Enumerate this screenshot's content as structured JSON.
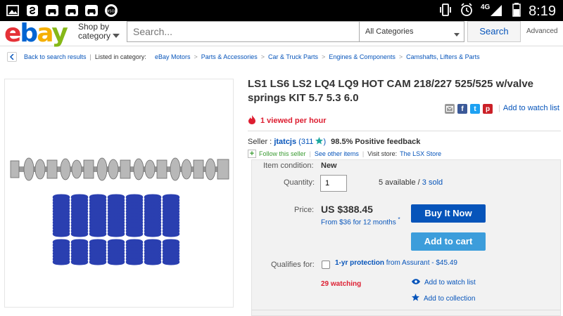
{
  "status_bar": {
    "time": "8:19",
    "network": "4G",
    "left_icons": [
      "gallery-icon",
      "shazam-icon",
      "car-icon",
      "car-icon",
      "car-icon",
      "wsop-icon"
    ],
    "right_icons": [
      "vibrate-icon",
      "alarm-icon",
      "signal-icon",
      "battery-icon"
    ]
  },
  "header": {
    "logo": {
      "e": "e",
      "b": "b",
      "a": "a",
      "y": "y"
    },
    "shop_by_line1": "Shop by",
    "shop_by_line2": "category",
    "search_placeholder": "Search...",
    "category_selected": "All Categories",
    "search_button": "Search",
    "advanced": "Advanced"
  },
  "breadcrumb": {
    "back": "Back to search results",
    "listed_in": "Listed in category:",
    "items": [
      "eBay Motors",
      "Parts & Accessories",
      "Car & Truck Parts",
      "Engines & Components",
      "Camshafts, Lifters & Parts"
    ]
  },
  "listing": {
    "title": "LS1 LS6 LS2 LQ4 LQ9 HOT CAM 218/227 525/525 w/valve springs KIT 5.7 5.3 6.0",
    "viewed": "1 viewed per hour",
    "watch_list_link": "Add to watch list",
    "share_icons": [
      "email-icon",
      "facebook-icon",
      "twitter-icon",
      "pinterest-icon"
    ]
  },
  "seller": {
    "label": "Seller :",
    "name": "jtatcjs",
    "feedback_count": "(311",
    "feedback_close": ")",
    "positive": "98.5% Positive feedback",
    "follow": "Follow this seller",
    "see_other": "See other items",
    "visit_label": "Visit store:",
    "store": "The LSX Store"
  },
  "purchase": {
    "condition_label": "Item condition:",
    "condition_value": "New",
    "quantity_label": "Quantity:",
    "quantity_value": "1",
    "available": "5 available /",
    "sold": "3 sold",
    "price_label": "Price:",
    "price": "US $388.45",
    "monthly": "From $36 for 12 months",
    "monthly_mark": "*",
    "buy_now": "Buy It Now",
    "add_to_cart": "Add to cart",
    "qualifies_label": "Qualifies for:",
    "protection_bold": "1-yr protection",
    "protection_rest": " from Assurant - $45.49",
    "watching": "29 watching",
    "add_watch": "Add to watch list",
    "add_collection": "Add to collection"
  },
  "colors": {
    "ebay_red": "#e53238",
    "ebay_blue": "#0064d2",
    "ebay_yellow": "#f5af02",
    "ebay_green": "#86b817",
    "buy_now": "#0654ba",
    "add_to_cart": "#3c9ddb",
    "alert_red": "#dd1e31"
  }
}
